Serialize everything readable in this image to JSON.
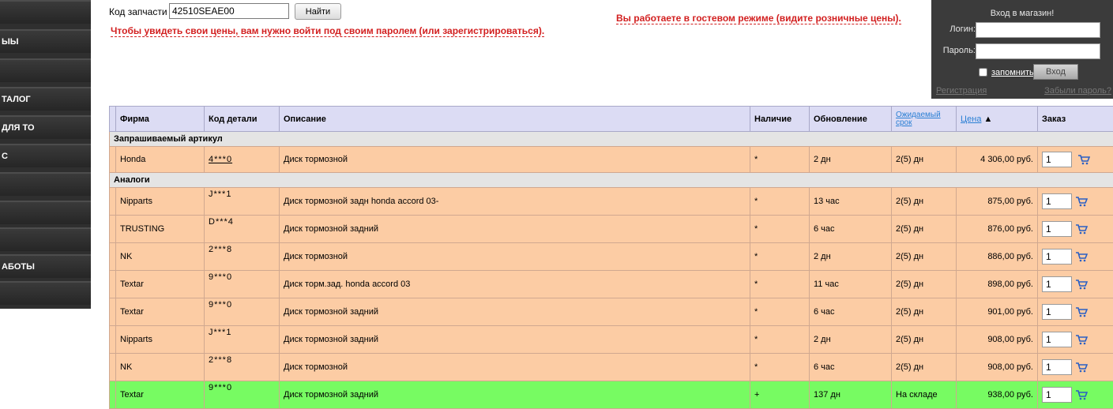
{
  "sidebar": {
    "items": [
      "",
      "ЫЫ",
      "",
      "ТАЛОГ",
      "ДЛЯ ТО",
      "С",
      "",
      "",
      "",
      "АБОТЫ",
      ""
    ]
  },
  "search": {
    "label": "Код запчасти",
    "value": "42510SEAE00",
    "button": "Найти",
    "login_hint": "Чтобы увидеть свои цены, вам нужно войти под своим паролем (или зарегистрироваться).",
    "guest_note": "Вы работаете в гостевом режиме (видите розничные цены)."
  },
  "login": {
    "title": "Вход в магазин!",
    "login_label": "Логин:",
    "password_label": "Пароль:",
    "remember": "запомнить",
    "button": "Вход",
    "register": "Регистрация",
    "forgot": "Забыли пароль?"
  },
  "table": {
    "headers": {
      "firm": "Фирма",
      "code": "Код детали",
      "desc": "Описание",
      "avail": "Наличие",
      "update": "Обновление",
      "expected_1": "Ожидаемый",
      "expected_2": "срок",
      "price": "Цена",
      "price_sort": "▲",
      "order": "Заказ"
    },
    "group_requested": "Запрашиваемый артикул",
    "group_analogs": "Аналоги",
    "requested": {
      "firm": "Honda",
      "code": "4***0",
      "desc": "Диск тормозной",
      "avail": "*",
      "update": "2 дн",
      "expected": "2(5) дн",
      "price": "4 306,00 руб.",
      "qty": "1"
    },
    "analogs": [
      {
        "firm": "Nipparts",
        "code": "J***1",
        "desc": "Диск тормозной задн honda accord 03-",
        "avail": "*",
        "update": "13 час",
        "expected": "2(5) дн",
        "price": "875,00 руб.",
        "qty": "1"
      },
      {
        "firm": "TRUSTING",
        "code": "D***4",
        "desc": "Диск тормозной задний",
        "avail": "*",
        "update": "6 час",
        "expected": "2(5) дн",
        "price": "876,00 руб.",
        "qty": "1"
      },
      {
        "firm": "NK",
        "code": "2***8",
        "desc": "Диск тормозной",
        "avail": "*",
        "update": "2 дн",
        "expected": "2(5) дн",
        "price": "886,00 руб.",
        "qty": "1"
      },
      {
        "firm": "Textar",
        "code": "9***0",
        "desc": "Диск торм.зад. honda accord 03",
        "avail": "*",
        "update": "11 час",
        "expected": "2(5) дн",
        "price": "898,00 руб.",
        "qty": "1"
      },
      {
        "firm": "Textar",
        "code": "9***0",
        "desc": "Диск тормозной задний",
        "avail": "*",
        "update": "6 час",
        "expected": "2(5) дн",
        "price": "901,00 руб.",
        "qty": "1"
      },
      {
        "firm": "Nipparts",
        "code": "J***1",
        "desc": "Диск тормозной задний",
        "avail": "*",
        "update": "2 дн",
        "expected": "2(5) дн",
        "price": "908,00 руб.",
        "qty": "1"
      },
      {
        "firm": "NK",
        "code": "2***8",
        "desc": "Диск тормозной",
        "avail": "*",
        "update": "6 час",
        "expected": "2(5) дн",
        "price": "908,00 руб.",
        "qty": "1"
      },
      {
        "firm": "Textar",
        "code": "9***0",
        "desc": "Диск тормозной задний",
        "avail": "+",
        "update": "137 дн",
        "expected": "На складе",
        "price": "938,00 руб.",
        "qty": "1"
      }
    ]
  },
  "colors": {
    "row_default": "#fccca4",
    "row_instock": "#77fb62",
    "header": "#dcdcf4",
    "warning_text": "#d21f1f",
    "cart_icon": "#2a5fc4"
  },
  "icons": {
    "order": "shopping-cart-icon"
  }
}
